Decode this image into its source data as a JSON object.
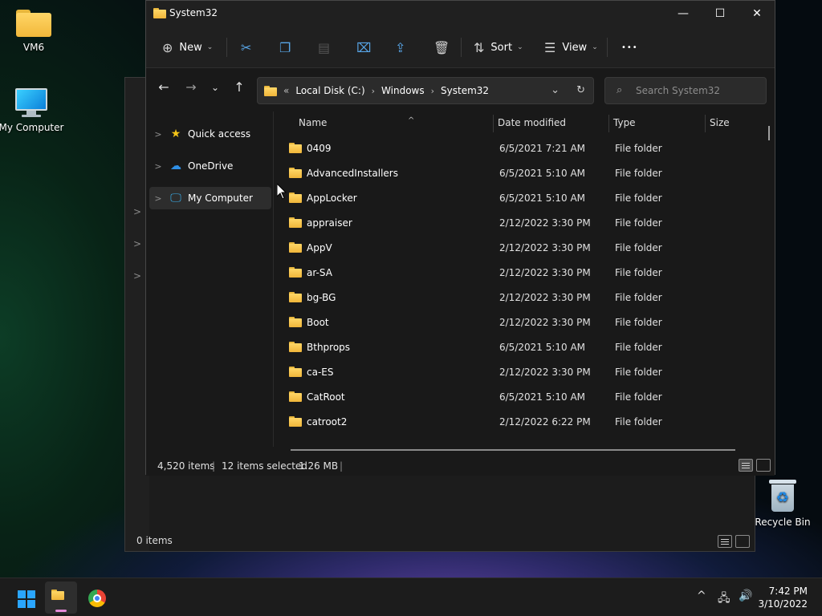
{
  "desktop": {
    "icons": [
      {
        "label": "VM6"
      },
      {
        "label": "My Computer"
      },
      {
        "label": "Recycle Bin"
      }
    ]
  },
  "back_window": {
    "status": "0 items"
  },
  "window": {
    "title": "System32",
    "toolbar": {
      "new_label": "New",
      "sort_label": "Sort",
      "view_label": "View",
      "more_label": "•••"
    },
    "address": {
      "overflow": "«",
      "crumbs": [
        "Local Disk (C:)",
        "Windows",
        "System32"
      ]
    },
    "search": {
      "placeholder": "Search System32"
    },
    "nav": [
      {
        "label": "Quick access"
      },
      {
        "label": "OneDrive"
      },
      {
        "label": "My Computer"
      }
    ],
    "columns": {
      "name": "Name",
      "date": "Date modified",
      "type": "Type",
      "size": "Size"
    },
    "rows": [
      {
        "name": "0409",
        "date": "6/5/2021 7:21 AM",
        "type": "File folder"
      },
      {
        "name": "AdvancedInstallers",
        "date": "6/5/2021 5:10 AM",
        "type": "File folder"
      },
      {
        "name": "AppLocker",
        "date": "6/5/2021 5:10 AM",
        "type": "File folder"
      },
      {
        "name": "appraiser",
        "date": "2/12/2022 3:30 PM",
        "type": "File folder"
      },
      {
        "name": "AppV",
        "date": "2/12/2022 3:30 PM",
        "type": "File folder"
      },
      {
        "name": "ar-SA",
        "date": "2/12/2022 3:30 PM",
        "type": "File folder"
      },
      {
        "name": "bg-BG",
        "date": "2/12/2022 3:30 PM",
        "type": "File folder"
      },
      {
        "name": "Boot",
        "date": "2/12/2022 3:30 PM",
        "type": "File folder"
      },
      {
        "name": "Bthprops",
        "date": "6/5/2021 5:10 AM",
        "type": "File folder"
      },
      {
        "name": "ca-ES",
        "date": "2/12/2022 3:30 PM",
        "type": "File folder"
      },
      {
        "name": "CatRoot",
        "date": "6/5/2021 5:10 AM",
        "type": "File folder"
      },
      {
        "name": "catroot2",
        "date": "2/12/2022 6:22 PM",
        "type": "File folder"
      }
    ],
    "status": {
      "count": "4,520 items",
      "selected": "12 items selected",
      "size": "1.26 MB"
    }
  },
  "taskbar": {
    "time": "7:42 PM",
    "date": "3/10/2022"
  },
  "colors": {
    "folder": "#f2b83a",
    "windows_blue": "#2aa6ff",
    "window_bg": "#191919"
  }
}
